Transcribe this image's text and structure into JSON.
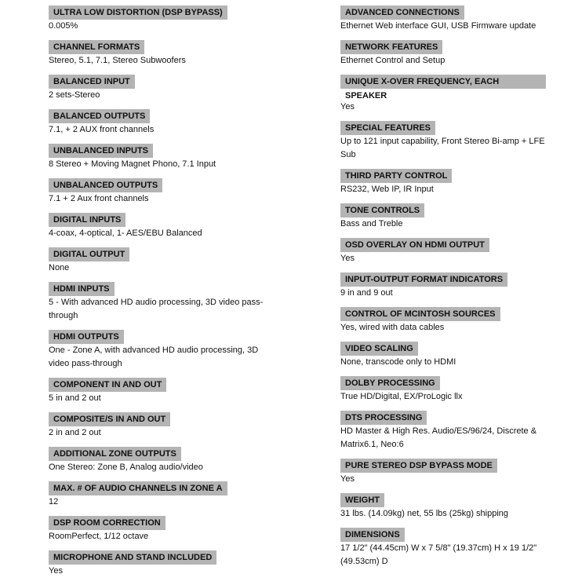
{
  "colors": {
    "header_bg": "#b4b4b4",
    "text": "#111111"
  },
  "left": [
    {
      "label": "ULTRA LOW DISTORTION (DSP BYPASS)",
      "value": "0.005%"
    },
    {
      "label": "CHANNEL FORMATS",
      "value": "Stereo, 5.1, 7.1, Stereo Subwoofers"
    },
    {
      "label": "BALANCED INPUT",
      "value": "2 sets-Stereo"
    },
    {
      "label": "BALANCED OUTPUTS",
      "value": "7.1, + 2 AUX front channels"
    },
    {
      "label": "UNBALANCED INPUTS",
      "value": "8 Stereo + Moving Magnet Phono, 7.1 Input"
    },
    {
      "label": "UNBALANCED OUTPUTS",
      "value": "7.1 + 2 Aux front channels"
    },
    {
      "label": "DIGITAL INPUTS",
      "value": "4-coax, 4-optical, 1- AES/EBU Balanced"
    },
    {
      "label": "DIGITAL OUTPUT",
      "value": "None"
    },
    {
      "label": "HDMI INPUTS",
      "value": "5 - With advanced HD audio processing, 3D video pass-through"
    },
    {
      "label": "HDMI OUTPUTS",
      "value": "One - Zone A, with advanced HD audio processing, 3D video pass-through"
    },
    {
      "label": "COMPONENT IN AND OUT",
      "value": "5 in and 2 out"
    },
    {
      "label": "COMPOSITE/S IN AND OUT",
      "value": "2 in and 2 out"
    },
    {
      "label": "ADDITIONAL ZONE OUTPUTS",
      "value": "One Stereo: Zone B, Analog audio/video"
    },
    {
      "label": "MAX. # OF AUDIO CHANNELS IN ZONE A",
      "value": "12"
    },
    {
      "label": "DSP ROOM CORRECTION",
      "value": "RoomPerfect, 1/12 octave"
    },
    {
      "label": "MICROPHONE AND STAND INCLUDED",
      "value": "Yes"
    }
  ],
  "right": [
    {
      "label": "ADVANCED CONNECTIONS",
      "value": "Ethernet Web interface GUI, USB Firmware update"
    },
    {
      "label": "NETWORK FEATURES",
      "value": "Ethernet Control and Setup"
    },
    {
      "label": "UNIQUE X-OVER FREQUENCY, EACH SPEAKER",
      "value": "Yes"
    },
    {
      "label": "SPECIAL FEATURES",
      "value": "Up to 121 input capability, Front Stereo Bi-amp + LFE Sub"
    },
    {
      "label": "THIRD PARTY CONTROL",
      "value": "RS232, Web IP, IR Input"
    },
    {
      "label": "TONE CONTROLS",
      "value": "Bass and Treble"
    },
    {
      "label": "OSD OVERLAY ON HDMI OUTPUT",
      "value": "Yes"
    },
    {
      "label": "INPUT-OUTPUT FORMAT INDICATORS",
      "value": "9 in and 9 out"
    },
    {
      "label": "CONTROL OF MCINTOSH SOURCES",
      "value": "Yes, wired with data cables"
    },
    {
      "label": "VIDEO SCALING",
      "value": "None, transcode only to HDMI"
    },
    {
      "label": "DOLBY PROCESSING",
      "value": "True HD/Digital, EX/ProLogic llx"
    },
    {
      "label": "DTS PROCESSING",
      "value": "HD Master & High Res. Audio/ES/96/24, Discrete & Matrix6.1, Neo:6"
    },
    {
      "label": "PURE STEREO DSP BYPASS MODE",
      "value": "Yes"
    },
    {
      "label": "WEIGHT",
      "value": "31 lbs. (14.09kg) net, 55 lbs (25kg) shipping"
    },
    {
      "label": "DIMENSIONS",
      "value": "17 1/2\" (44.45cm) W x 7 5/8\" (19.37cm) H x 19 1/2\" (49.53cm) D"
    }
  ]
}
